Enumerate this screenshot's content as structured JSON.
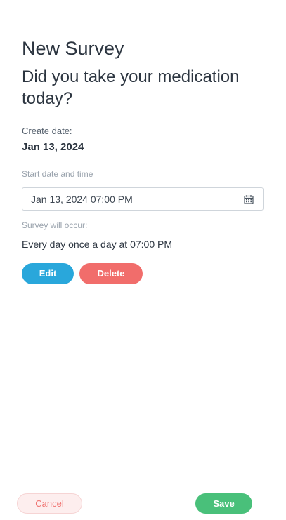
{
  "header": {
    "title": "New Survey",
    "question": "Did you take your medication today?"
  },
  "create_date": {
    "label": "Create date:",
    "value": "Jan 13, 2024"
  },
  "start": {
    "label": "Start date and time",
    "value": "Jan 13, 2024 07:00 PM",
    "icon": "calendar-icon"
  },
  "occurrence": {
    "label": "Survey will occur:",
    "value": "Every day once a day at 07:00 PM"
  },
  "actions": {
    "edit_label": "Edit",
    "delete_label": "Delete"
  },
  "footer": {
    "cancel_label": "Cancel",
    "save_label": "Save"
  },
  "colors": {
    "edit": "#29a7db",
    "delete": "#f16d6b",
    "save": "#49c07a",
    "cancel_text": "#f07370",
    "cancel_bg": "#fdeeee"
  }
}
